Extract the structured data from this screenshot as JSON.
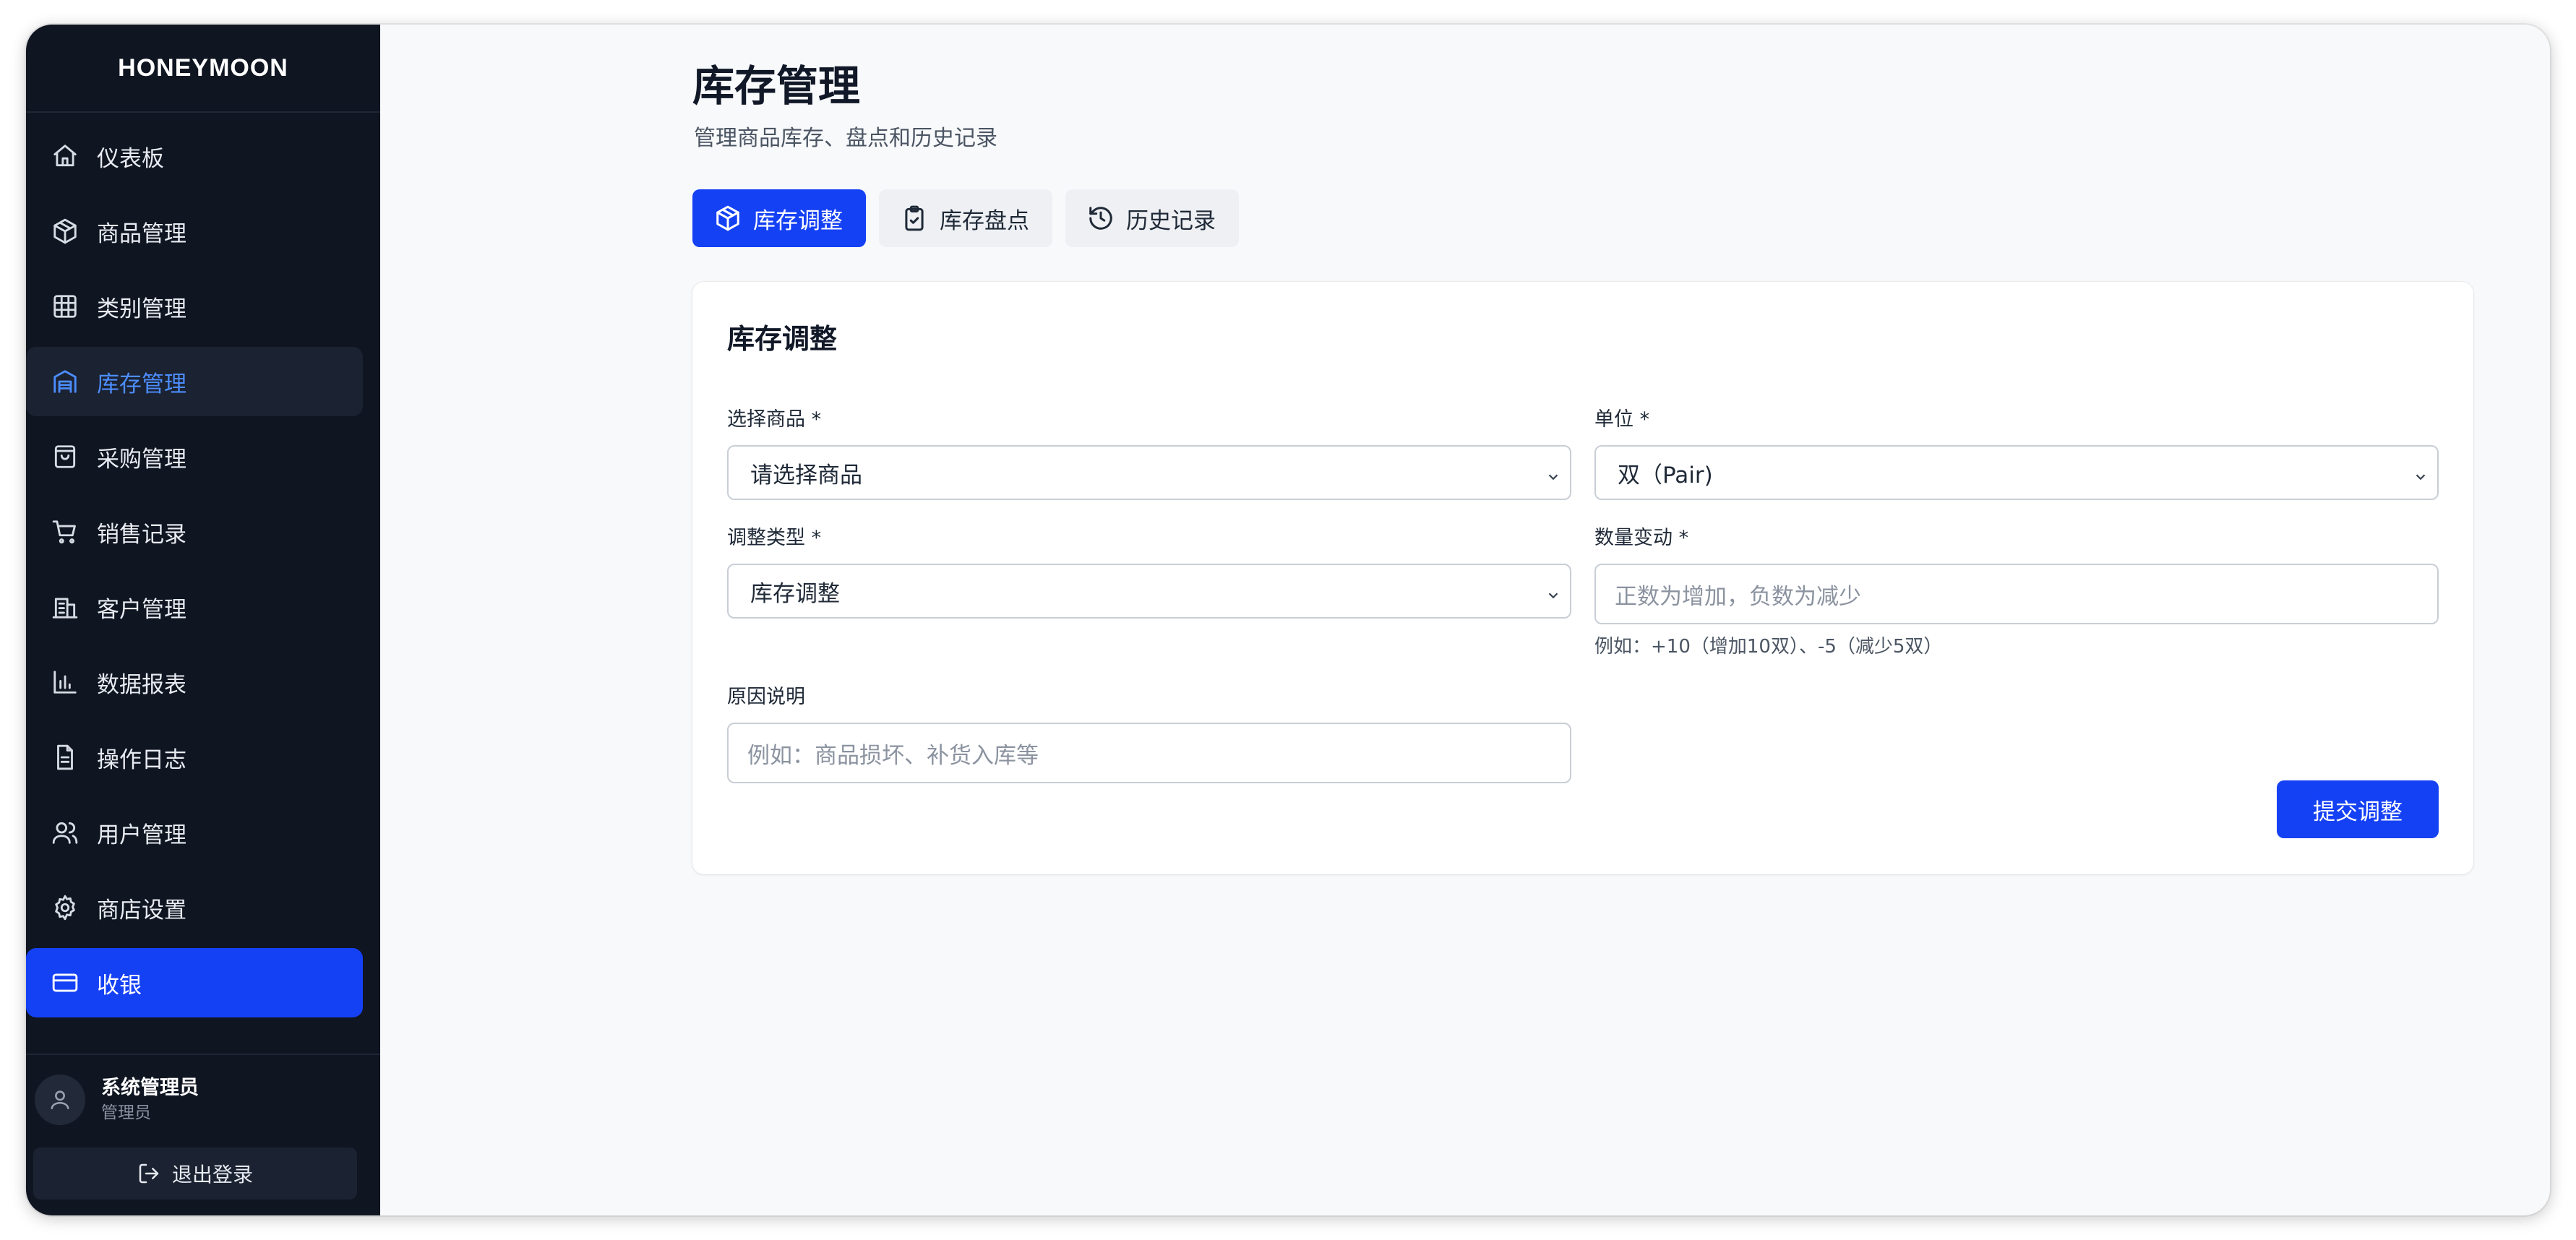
{
  "app": {
    "brand": "HONEYMOON"
  },
  "sidebar": {
    "items": [
      {
        "label": "仪表板",
        "icon": "home-icon"
      },
      {
        "label": "商品管理",
        "icon": "box-icon"
      },
      {
        "label": "类别管理",
        "icon": "grid-icon"
      },
      {
        "label": "库存管理",
        "icon": "warehouse-icon",
        "state": "selected"
      },
      {
        "label": "采购管理",
        "icon": "shopping-bag-icon"
      },
      {
        "label": "销售记录",
        "icon": "cart-icon"
      },
      {
        "label": "客户管理",
        "icon": "building-icon"
      },
      {
        "label": "数据报表",
        "icon": "bar-chart-icon"
      },
      {
        "label": "操作日志",
        "icon": "file-text-icon"
      },
      {
        "label": "用户管理",
        "icon": "users-icon"
      },
      {
        "label": "商店设置",
        "icon": "gear-icon"
      },
      {
        "label": "收银",
        "icon": "credit-card-icon",
        "state": "highlight"
      }
    ],
    "user": {
      "name": "系统管理员",
      "role": "管理员"
    },
    "logout_label": "退出登录"
  },
  "main": {
    "title": "库存管理",
    "subtitle": "管理商品库存、盘点和历史记录",
    "tabs": [
      {
        "label": "库存调整",
        "icon": "box-icon",
        "active": true
      },
      {
        "label": "库存盘点",
        "icon": "clipboard-check-icon",
        "active": false
      },
      {
        "label": "历史记录",
        "icon": "history-icon",
        "active": false
      }
    ]
  },
  "form": {
    "title": "库存调整",
    "product": {
      "label": "选择商品 *",
      "value": "请选择商品"
    },
    "unit": {
      "label": "单位 *",
      "value": "双（Pair)"
    },
    "type": {
      "label": "调整类型 *",
      "value": "库存调整"
    },
    "quantity": {
      "label": "数量变动 *",
      "placeholder": "正数为增加，负数为减少",
      "hint": "例如：+10（增加10双）、-5（减少5双）"
    },
    "reason": {
      "label": "原因说明",
      "placeholder": "例如：商品损坏、补货入库等"
    },
    "submit_label": "提交调整"
  },
  "colors": {
    "accent": "#1541f5",
    "sidebar_bg": "#0f1521",
    "page_bg": "#f8f9fb"
  }
}
